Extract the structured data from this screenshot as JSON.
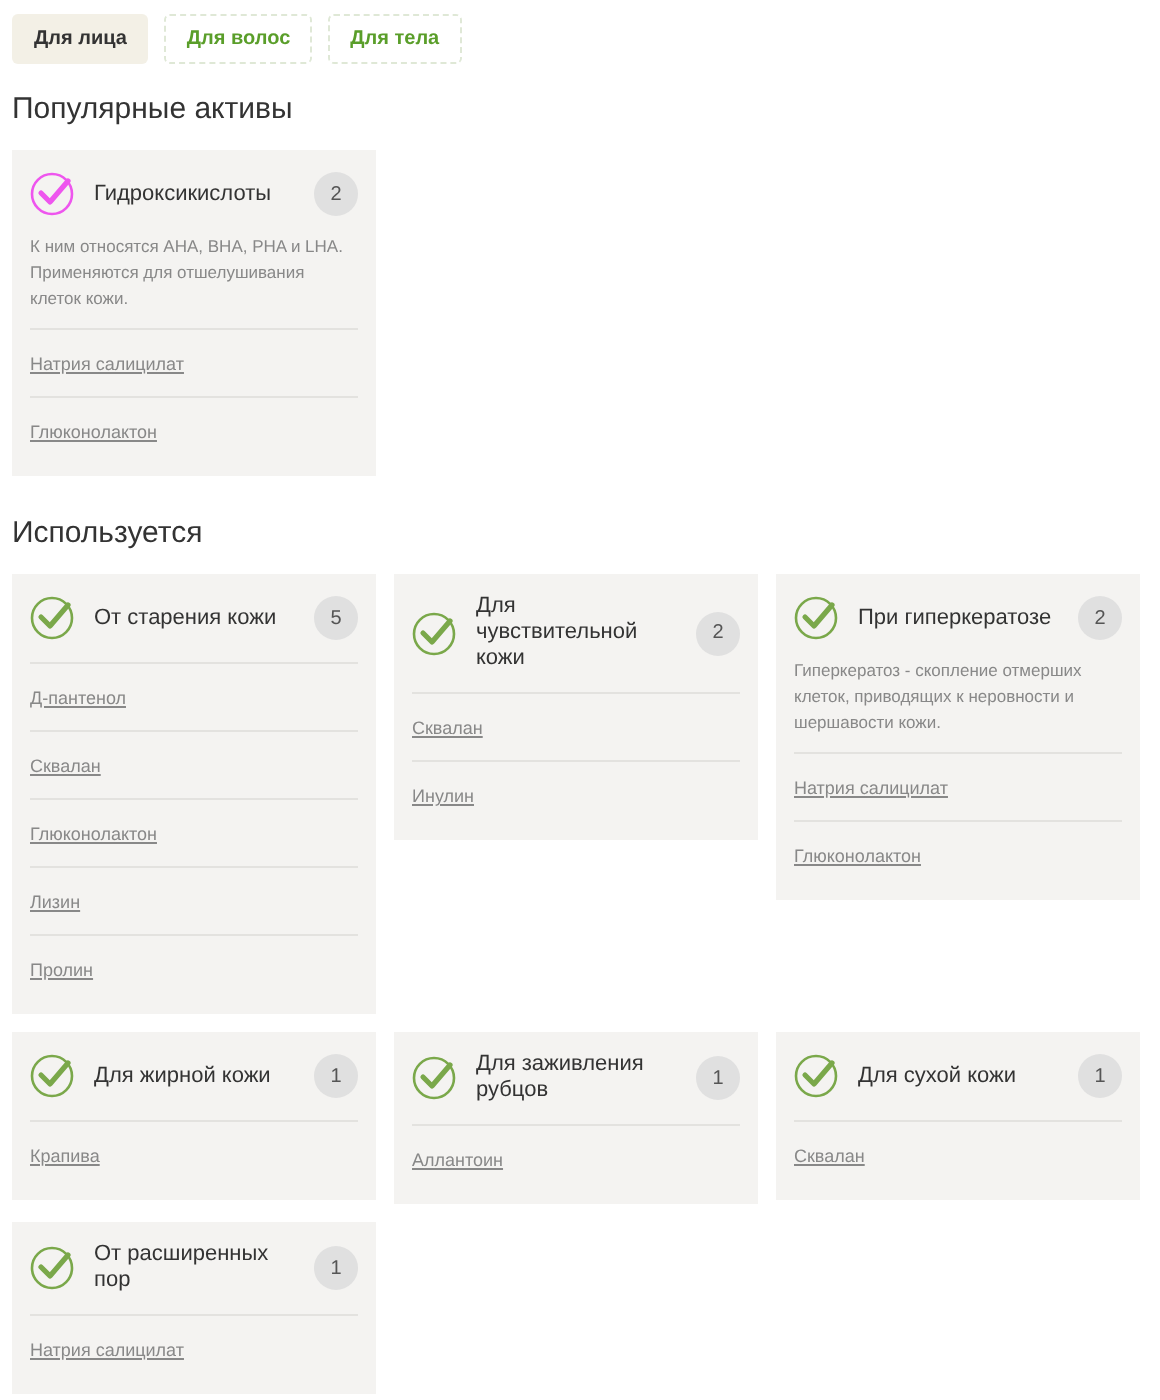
{
  "tabs": [
    {
      "label": "Для лица",
      "selected": true
    },
    {
      "label": "Для волос",
      "selected": false
    },
    {
      "label": "Для тела",
      "selected": false
    }
  ],
  "sections": [
    {
      "title": "Популярные активы",
      "cards": [
        {
          "title": "Гидроксикислоты",
          "count": "2",
          "color": "#ee55ee",
          "description": "К ним относятся AHA, BHA, PHA и LHA. Применяются для отшелушивания клеток кожи.",
          "links": [
            "Натрия салицилат",
            "Глюконолактон"
          ]
        }
      ]
    },
    {
      "title": "Используется",
      "cards": [
        {
          "title": "От старения кожи",
          "count": "5",
          "color": "#7aa84a",
          "links": [
            "Д-пантенол",
            "Сквалан",
            "Глюконолактон",
            "Лизин",
            "Пролин"
          ]
        },
        {
          "title": "Для чувствительной кожи",
          "count": "2",
          "color": "#7aa84a",
          "links": [
            "Сквалан",
            "Инулин"
          ]
        },
        {
          "title": "При гиперкератозе",
          "count": "2",
          "color": "#7aa84a",
          "description": "Гиперкератоз - скопление отмерших клеток, приводящих к неровности и шершавости кожи.",
          "links": [
            "Натрия салицилат",
            "Глюконолактон"
          ]
        },
        {
          "title": "Для жирной кожи",
          "count": "1",
          "color": "#7aa84a",
          "links": [
            "Крапива"
          ]
        },
        {
          "title": "Для заживления рубцов",
          "count": "1",
          "color": "#7aa84a",
          "links": [
            "Аллантоин"
          ]
        },
        {
          "title": "Для сухой кожи",
          "count": "1",
          "color": "#7aa84a",
          "links": [
            "Сквалан"
          ]
        },
        {
          "title": "От расширенных пор",
          "count": "1",
          "color": "#7aa84a",
          "links": [
            "Натрия салицилат"
          ]
        }
      ]
    }
  ]
}
